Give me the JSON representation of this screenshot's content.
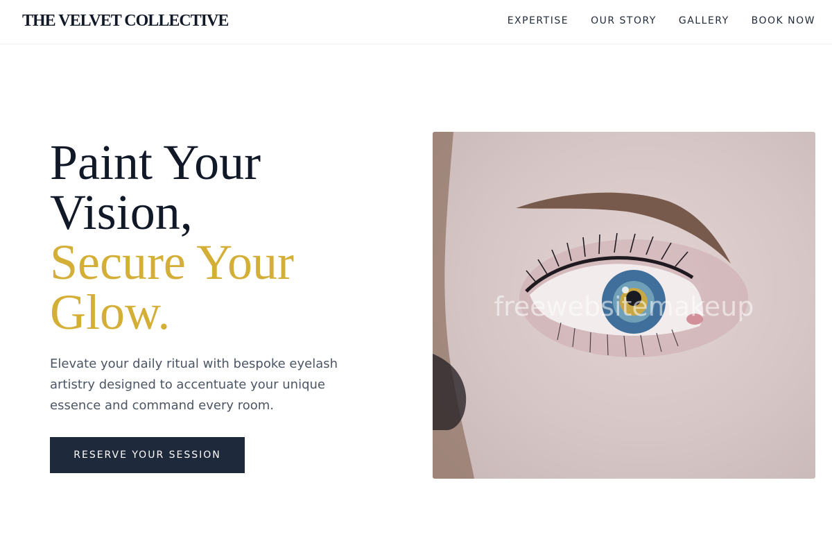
{
  "brand": {
    "name": "THE VELVET COLLECTIVE"
  },
  "nav": {
    "items": [
      {
        "label": "EXPERTISE"
      },
      {
        "label": "OUR STORY"
      },
      {
        "label": "GALLERY"
      },
      {
        "label": "BOOK NOW"
      }
    ]
  },
  "hero": {
    "title_line1": "Paint Your",
    "title_line2": "Vision,",
    "title_line3": "Secure Your",
    "title_line4": "Glow.",
    "description": "Elevate your daily ritual with bespoke eyelash artistry designed to accentuate your unique essence and command every room.",
    "cta_label": "RESERVE YOUR SESSION",
    "image_watermark": "freewebsitemakeup"
  },
  "colors": {
    "accent_gold": "#d4af37",
    "button_navy": "#1e293b",
    "text_dark": "#111827"
  }
}
